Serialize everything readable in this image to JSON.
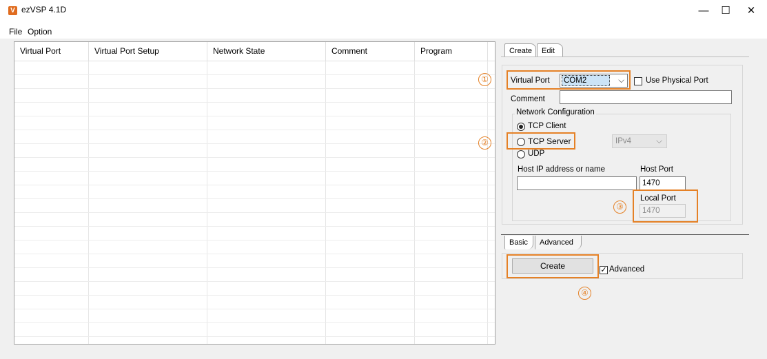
{
  "window": {
    "title": "ezVSP 4.1D",
    "icon_letter": "V",
    "controls": {
      "minimize": "—",
      "maximize": "☐",
      "close": "✕"
    }
  },
  "menu": {
    "items": [
      "File",
      "Option"
    ]
  },
  "table": {
    "columns": [
      "Virtual Port",
      "Virtual Port Setup",
      "Network State",
      "Comment",
      "Program"
    ]
  },
  "tabs_top": {
    "create": "Create",
    "edit": "Edit"
  },
  "create_form": {
    "virtual_port_label": "Virtual Port",
    "virtual_port_value": "COM2",
    "use_physical_port_label": "Use Physical Port",
    "comment_label": "Comment",
    "comment_value": "",
    "network_config_label": "Network Configuration",
    "tcp_client_label": "TCP Client",
    "tcp_server_label": "TCP Server",
    "udp_label": "UDP",
    "ip_version_value": "IPv4",
    "host_ip_label": "Host IP address or name",
    "host_ip_value": "",
    "host_port_label": "Host Port",
    "host_port_value": "1470",
    "local_port_label": "Local Port",
    "local_port_value": "1470"
  },
  "tabs_bottom": {
    "basic": "Basic",
    "advanced": "Advanced"
  },
  "basic_form": {
    "create_button": "Create",
    "advanced_checkbox_label": "Advanced",
    "advanced_checked_mark": "✓"
  },
  "markers": [
    "①",
    "②",
    "③",
    "④"
  ],
  "colors": {
    "highlight": "#e58126",
    "app_icon": "#e06c1f"
  }
}
